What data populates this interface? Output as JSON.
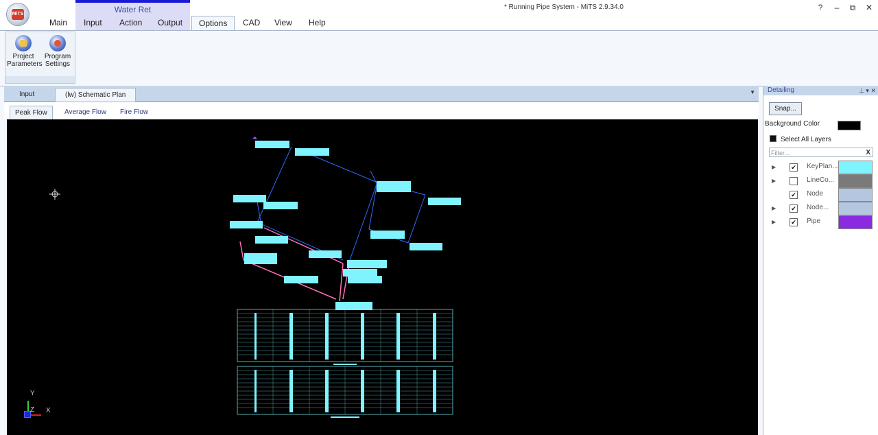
{
  "window": {
    "title": "* Running Pipe System - MiTS 2.9.34.0",
    "app_logo": "MiTS",
    "controls": [
      "?",
      "–",
      "⧉",
      "✕"
    ]
  },
  "ribbon": {
    "contextual_group": "Water Ret",
    "tabs": [
      "Main",
      "Input",
      "Action",
      "Output",
      "Options",
      "CAD",
      "View",
      "Help"
    ],
    "active_tab": "Options",
    "buttons": [
      {
        "label_line1": "Project",
        "label_line2": "Parameters",
        "icon": "project-parameters-icon"
      },
      {
        "label_line1": "Program",
        "label_line2": "Settings",
        "icon": "program-settings-icon"
      }
    ]
  },
  "document": {
    "tabs": [
      "Input",
      "(lw) Schematic Plan"
    ],
    "active_tab": "(lw) Schematic Plan",
    "sub_tabs": [
      "Peak Flow",
      "Average Flow",
      "Fire Flow"
    ],
    "active_sub_tab": "Peak Flow"
  },
  "canvas": {
    "axis_labels": {
      "y": "Y",
      "z": "Z",
      "x": "X"
    },
    "background": "#000000",
    "accent": "#7ff4ff"
  },
  "detailing": {
    "title": "Detailing",
    "snap_label": "Snap...",
    "background_color_label": "Background Color",
    "background_color": "#000000",
    "select_all_label": "Select All Layers",
    "filter_placeholder": "Filter...",
    "filter_clear": "X",
    "layers": [
      {
        "name": "KeyPlan...",
        "checked": true,
        "expandable": true,
        "color": "#7ff4ff"
      },
      {
        "name": "LineCo...",
        "checked": false,
        "expandable": true,
        "color": "#7a7a7a"
      },
      {
        "name": "Node",
        "checked": true,
        "expandable": false,
        "color": "#b4c6e0"
      },
      {
        "name": "Node...",
        "checked": true,
        "expandable": true,
        "color": "#b4c6e0"
      },
      {
        "name": "Pipe",
        "checked": true,
        "expandable": true,
        "color": "#8a2be2"
      }
    ]
  }
}
